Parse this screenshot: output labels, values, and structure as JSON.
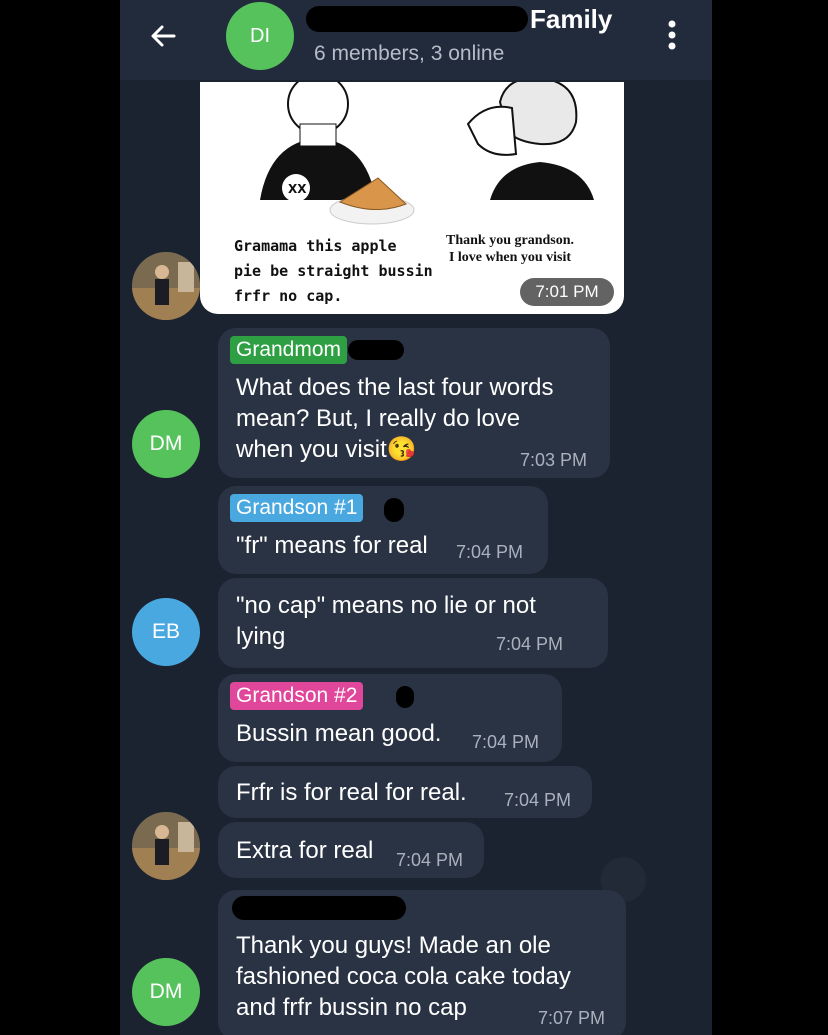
{
  "header": {
    "avatar_initials": "DI",
    "title": "Family",
    "subtitle": "6 members, 3 online"
  },
  "meme": {
    "left_caption": "Gramama this apple\npie be straight bussin\nfrfr no cap.",
    "right_caption": "Thank you grandson.\nI love when you visit",
    "time": "7:01 PM"
  },
  "messages": [
    {
      "sender": "Grandmom",
      "sender_color": "#2ea043",
      "text": "What does the last four words\nmean? But, I really do love\nwhen you visit😘",
      "time": "7:03 PM",
      "avatar": "DM"
    },
    {
      "sender": "Grandson #1",
      "sender_color": "#4aa8e0",
      "text": "\"fr\" means for real",
      "time": "7:04 PM"
    },
    {
      "text": "\"no cap\" means no lie or not\nlying",
      "time": "7:04 PM",
      "avatar": "EB"
    },
    {
      "sender": "Grandson #2",
      "sender_color": "#e0479a",
      "text": "Bussin mean good.",
      "time": "7:04 PM"
    },
    {
      "text": "Frfr is for real for real.",
      "time": "7:04 PM"
    },
    {
      "text": "Extra for real",
      "time": "7:04 PM"
    },
    {
      "text": "Thank you guys! Made an ole\nfashioned coca cola cake today\nand frfr bussin no cap",
      "time": "7:07 PM",
      "avatar": "DM"
    }
  ],
  "colors": {
    "background": "#1b2230",
    "header": "#222b3b",
    "bubble": "#2a3343",
    "avatar_green": "#56c25c",
    "avatar_blue": "#4aa8e0"
  }
}
